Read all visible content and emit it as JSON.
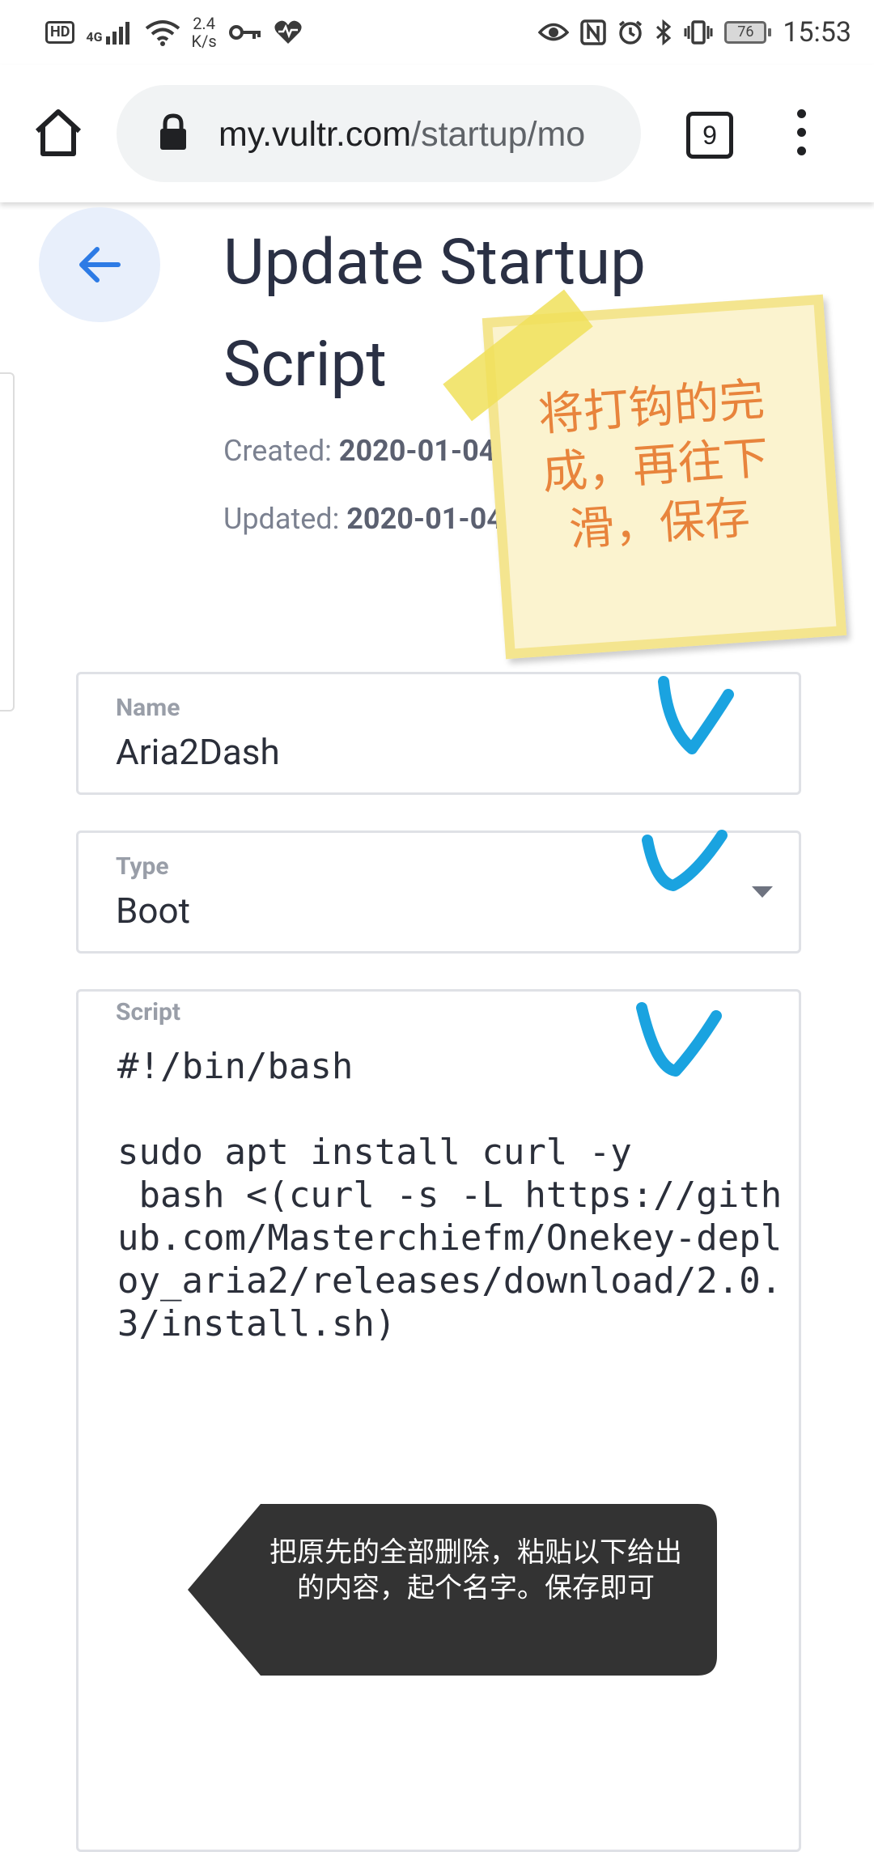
{
  "status_bar": {
    "hd": "HD",
    "network": "4G",
    "speed_value": "2.4",
    "speed_unit": "K/s",
    "battery": "76",
    "time": "15:53"
  },
  "browser": {
    "url_domain": "my.vultr.com",
    "url_path": "/startup/mo",
    "tab_count": "9"
  },
  "page": {
    "title": "Update Startup Script",
    "created_label": "Created:",
    "created_value": "2020-01-04",
    "updated_label": "Updated:",
    "updated_value": "2020-01-04"
  },
  "form": {
    "name_label": "Name",
    "name_value": "Aria2Dash",
    "type_label": "Type",
    "type_value": "Boot",
    "script_label": "Script",
    "script_value": "#!/bin/bash\n\nsudo apt install curl -y\n bash <(curl -s -L https://github.com/Masterchiefm/Onekey-deploy_aria2/releases/download/2.0.3/install.sh)"
  },
  "annotations": {
    "sticky_note": "将打钩的完成，再往下滑，保存",
    "callout": "把原先的全部删除，粘贴以下给出的内容，起个名字。保存即可",
    "check_color": "#1aa3e0",
    "sticky_text_color": "#e8843c"
  }
}
